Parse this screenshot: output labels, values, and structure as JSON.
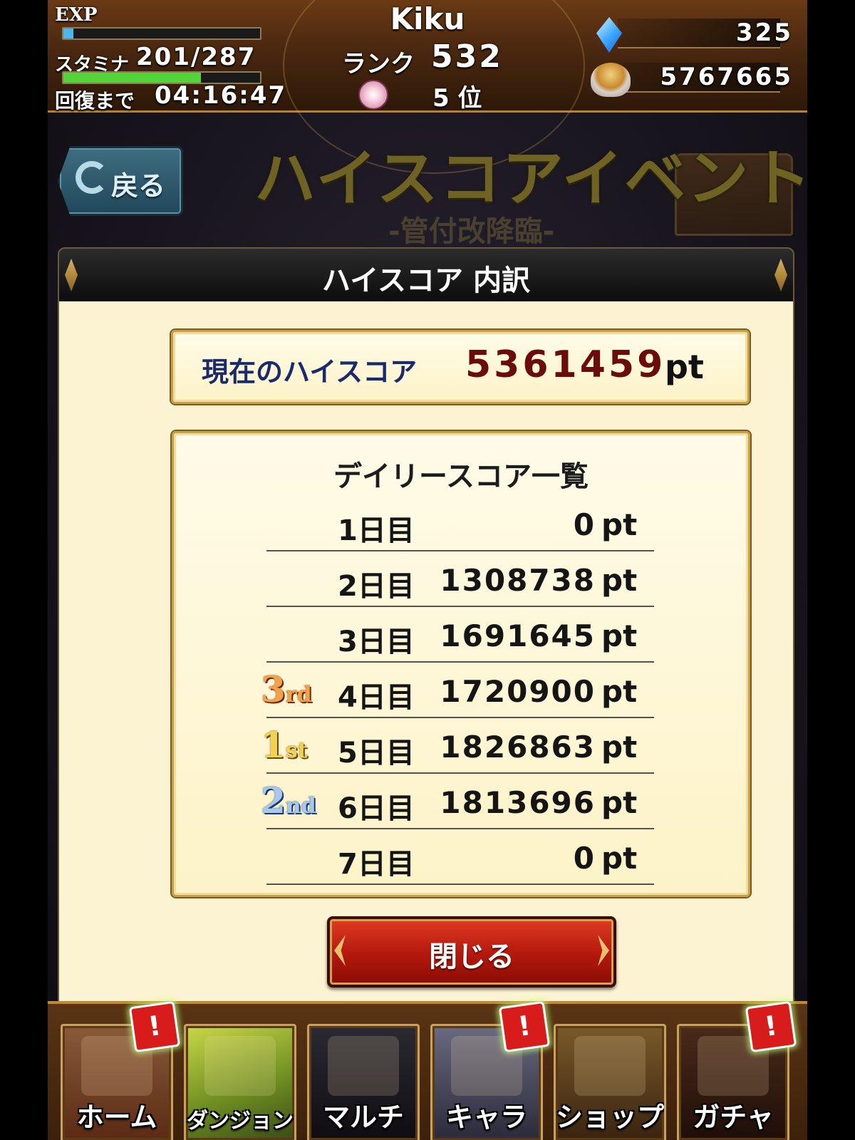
{
  "header": {
    "exp_label": "EXP",
    "exp_progress": 0.05,
    "stamina_label": "スタミナ",
    "stamina_value": "201/287",
    "stamina_progress": 0.7,
    "recovery_label": "回復まで",
    "recovery_time": "04:16:47",
    "player_name": "Kiku",
    "rank_label": "ランク",
    "rank_value": "532",
    "position_value": "5 位",
    "gems": "325",
    "coins": "5767665"
  },
  "banner": {
    "back_label": "戻る",
    "event_title": "ハイスコアイベント",
    "event_subtitle": "-管付改降臨-"
  },
  "dialog": {
    "title": "ハイスコア 内訳",
    "current_label": "現在のハイスコア",
    "current_value": "5361459",
    "current_unit": "pt",
    "daily_title": "デイリースコア一覧",
    "rows": [
      {
        "day": "1日目",
        "value": "0",
        "unit": "pt",
        "rank": null
      },
      {
        "day": "2日目",
        "value": "1308738",
        "unit": "pt",
        "rank": null
      },
      {
        "day": "3日目",
        "value": "1691645",
        "unit": "pt",
        "rank": null
      },
      {
        "day": "4日目",
        "value": "1720900",
        "unit": "pt",
        "rank": {
          "num": "3",
          "suffix": "rd"
        }
      },
      {
        "day": "5日目",
        "value": "1826863",
        "unit": "pt",
        "rank": {
          "num": "1",
          "suffix": "st"
        }
      },
      {
        "day": "6日目",
        "value": "1813696",
        "unit": "pt",
        "rank": {
          "num": "2",
          "suffix": "nd"
        }
      },
      {
        "day": "7日目",
        "value": "0",
        "unit": "pt",
        "rank": null
      }
    ],
    "close_label": "閉じる"
  },
  "nav": {
    "items": [
      {
        "label": "ホーム",
        "icon": "house-icon",
        "alert": "!"
      },
      {
        "label": "ダンジョン",
        "icon": "dungeon-map-icon",
        "alert": null
      },
      {
        "label": "マルチ",
        "icon": "dragon-icon",
        "alert": null
      },
      {
        "label": "キャラ",
        "icon": "character-icon",
        "alert": "!"
      },
      {
        "label": "ショップ",
        "icon": "shop-bag-icon",
        "alert": null
      },
      {
        "label": "ガチャ",
        "icon": "gacha-book-icon",
        "alert": "!"
      }
    ]
  },
  "colors": {
    "highscore_value": "#6a0c0c",
    "highscore_label": "#1a2a6a",
    "close_button": "#c2200f",
    "stamina_bar": "#55d43a",
    "exp_bar": "#49b8ee"
  }
}
